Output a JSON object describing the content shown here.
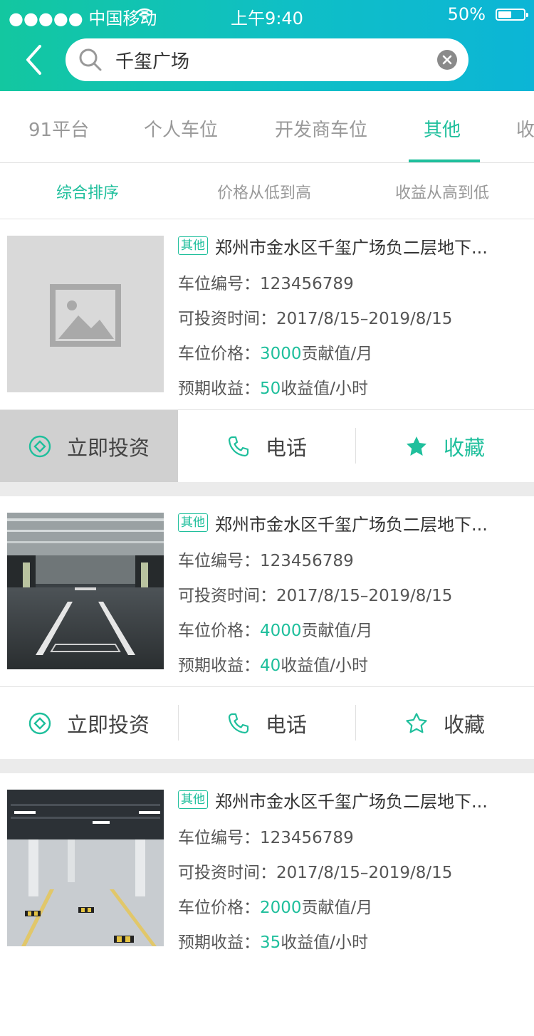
{
  "status_bar": {
    "carrier": "●●●●● 中国移动",
    "time": "上午9:40",
    "battery": "50%"
  },
  "search": {
    "value": "千玺广场"
  },
  "tabs": [
    "91平台",
    "个人车位",
    "开发商车位",
    "其他",
    "收"
  ],
  "active_tab": "其他",
  "sort_options": [
    "综合排序",
    "价格从低到高",
    "收益从高到低"
  ],
  "active_sort": "综合排序",
  "labels": {
    "number": "车位编号：",
    "period": "可投资时间：",
    "price": "车位价格：",
    "earnings": "预期收益：",
    "price_unit": "贡献值/月",
    "earnings_unit": "收益值/小时"
  },
  "actions": {
    "invest": "立即投资",
    "phone": "电话",
    "favorite": "收藏"
  },
  "listings": [
    {
      "tag": "其他",
      "title": "郑州市金水区千玺广场负二层地下...",
      "number": "123456789",
      "period": "2017/8/15–2019/8/15",
      "price": "3000",
      "earnings": "50",
      "image": "placeholder",
      "favorited": true,
      "invest_pressed": true
    },
    {
      "tag": "其他",
      "title": "郑州市金水区千玺广场负二层地下...",
      "number": "123456789",
      "period": "2017/8/15–2019/8/15",
      "price": "4000",
      "earnings": "40",
      "image": "parking-garage-dark",
      "favorited": false,
      "invest_pressed": false
    },
    {
      "tag": "其他",
      "title": "郑州市金水区千玺广场负二层地下...",
      "number": "123456789",
      "period": "2017/8/15–2019/8/15",
      "price": "2000",
      "earnings": "35",
      "image": "parking-garage-bright",
      "favorited": false,
      "invest_pressed": false
    }
  ],
  "colors": {
    "accent": "#1fbf9c",
    "header_start": "#13c7a0",
    "header_end": "#0cb5d6"
  }
}
